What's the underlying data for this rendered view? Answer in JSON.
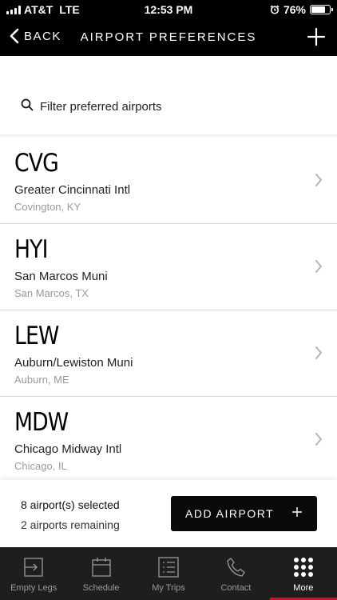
{
  "status_bar": {
    "carrier": "AT&T",
    "network": "LTE",
    "time": "12:53 PM",
    "battery": "76%",
    "battery_level": 0.76
  },
  "nav": {
    "back_label": "BACK",
    "title": "AIRPORT PREFERENCES",
    "add_icon": "plus-icon"
  },
  "filter": {
    "placeholder": "Filter preferred airports",
    "icon": "search-icon"
  },
  "airports": [
    {
      "code": "CVG",
      "name": "Greater Cincinnati Intl",
      "city": "Covington, KY"
    },
    {
      "code": "HYI",
      "name": "San Marcos Muni",
      "city": "San Marcos, TX"
    },
    {
      "code": "LEW",
      "name": "Auburn/Lewiston Muni",
      "city": "Auburn, ME"
    },
    {
      "code": "MDW",
      "name": "Chicago Midway Intl",
      "city": "Chicago, IL"
    }
  ],
  "footer": {
    "selected": "8 airport(s) selected",
    "remaining": "2 airports remaining",
    "add_label": "ADD AIRPORT"
  },
  "tabs": [
    {
      "label": "Empty Legs",
      "icon": "export-icon"
    },
    {
      "label": "Schedule",
      "icon": "calendar-icon"
    },
    {
      "label": "My Trips",
      "icon": "list-icon"
    },
    {
      "label": "Contact",
      "icon": "phone-icon"
    },
    {
      "label": "More",
      "icon": "grid-icon",
      "active": true
    }
  ],
  "colors": {
    "accent": "#c8102e",
    "bar_background": "#000000",
    "tab_background": "#1e1e1e"
  }
}
